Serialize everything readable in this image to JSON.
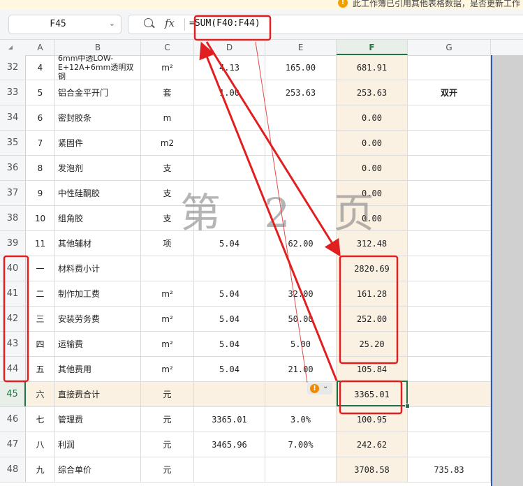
{
  "notice": {
    "icon": "warning-icon",
    "text": "此工作簿已引用其他表格数据，是否更新工作"
  },
  "formula_bar": {
    "cell_ref": "F45",
    "fx_label": "fx",
    "formula": "=SUM(F40:F44)"
  },
  "columns": [
    "A",
    "B",
    "C",
    "D",
    "E",
    "F",
    "G"
  ],
  "active": {
    "column": "F",
    "row": "45"
  },
  "rows": [
    {
      "num": "32",
      "a": "4",
      "b": "6mm中透LOW-E+12A+6mm透明双钢",
      "c": "m²",
      "d": "4.13",
      "e": "165.00",
      "f": "681.91",
      "g": ""
    },
    {
      "num": "33",
      "a": "5",
      "b": "铝合金平开门",
      "c": "套",
      "d": "1.00",
      "e": "253.63",
      "f": "253.63",
      "g": "双开"
    },
    {
      "num": "34",
      "a": "6",
      "b": "密封胶条",
      "c": "m",
      "d": "",
      "e": "",
      "f": "0.00",
      "g": ""
    },
    {
      "num": "35",
      "a": "7",
      "b": "紧固件",
      "c": "m2",
      "d": "",
      "e": "",
      "f": "0.00",
      "g": ""
    },
    {
      "num": "36",
      "a": "8",
      "b": "发泡剂",
      "c": "支",
      "d": "",
      "e": "",
      "f": "0.00",
      "g": ""
    },
    {
      "num": "37",
      "a": "9",
      "b": "中性硅酮胶",
      "c": "支",
      "d": "",
      "e": "",
      "f": "0.00",
      "g": ""
    },
    {
      "num": "38",
      "a": "10",
      "b": "组角胶",
      "c": "支",
      "d": "",
      "e": "",
      "f": "0.00",
      "g": ""
    },
    {
      "num": "39",
      "a": "11",
      "b": "其他辅材",
      "c": "项",
      "d": "5.04",
      "e": "62.00",
      "f": "312.48",
      "g": ""
    },
    {
      "num": "40",
      "a": "一",
      "b": "材料费小计",
      "c": "",
      "d": "",
      "e": "",
      "f": "2820.69",
      "g": ""
    },
    {
      "num": "41",
      "a": "二",
      "b": "制作加工费",
      "c": "m²",
      "d": "5.04",
      "e": "32.00",
      "f": "161.28",
      "g": ""
    },
    {
      "num": "42",
      "a": "三",
      "b": "安装劳务费",
      "c": "m²",
      "d": "5.04",
      "e": "50.00",
      "f": "252.00",
      "g": ""
    },
    {
      "num": "43",
      "a": "四",
      "b": "运输费",
      "c": "m²",
      "d": "5.04",
      "e": "5.00",
      "f": "25.20",
      "g": ""
    },
    {
      "num": "44",
      "a": "五",
      "b": "其他费用",
      "c": "m²",
      "d": "5.04",
      "e": "21.00",
      "f": "105.84",
      "g": ""
    },
    {
      "num": "45",
      "a": "六",
      "b": "直接费合计",
      "c": "元",
      "d": "",
      "e": "",
      "f": "3365.01",
      "g": ""
    },
    {
      "num": "46",
      "a": "七",
      "b": "管理费",
      "c": "元",
      "d": "3365.01",
      "e": "3.0%",
      "f": "100.95",
      "g": ""
    },
    {
      "num": "47",
      "a": "八",
      "b": "利润",
      "c": "元",
      "d": "3465.96",
      "e": "7.00%",
      "f": "242.62",
      "g": ""
    },
    {
      "num": "48",
      "a": "九",
      "b": "综合单价",
      "c": "元",
      "d": "",
      "e": "",
      "f": "3708.58",
      "g": "735.83"
    }
  ],
  "watermark": "第 2 页",
  "colors": {
    "highlight": "#fbf1e3",
    "selection": "#217346",
    "annotation": "#e02020"
  }
}
